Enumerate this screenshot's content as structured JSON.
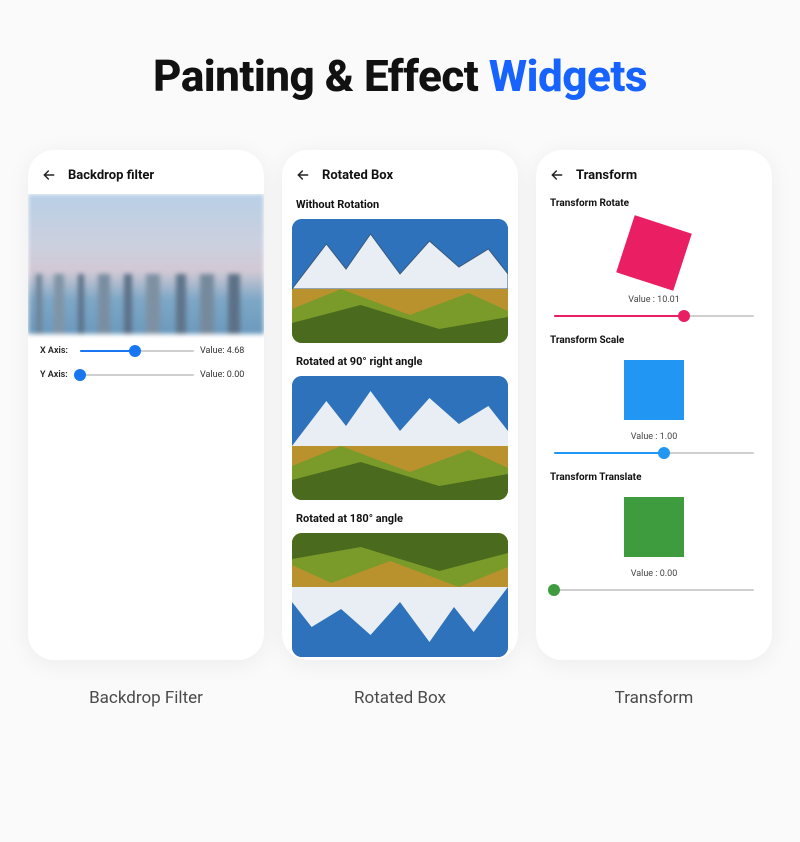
{
  "title": {
    "main": "Painting & Effect ",
    "accent": "Widgets"
  },
  "captions": [
    "Backdrop Filter",
    "Rotated Box",
    "Transform"
  ],
  "phone1": {
    "title": "Backdrop filter",
    "xAxis": {
      "label": "X Axis:",
      "valueLabel": "Value: 4.68",
      "pct": 48
    },
    "yAxis": {
      "label": "Y Axis:",
      "valueLabel": "Value: 0.00",
      "pct": 0
    }
  },
  "phone2": {
    "title": "Rotated Box",
    "sections": {
      "none": "Without Rotation",
      "r90": "Rotated at 90° right angle",
      "r180": "Rotated at 180° angle"
    }
  },
  "phone3": {
    "title": "Transform",
    "rotate": {
      "label": "Transform Rotate",
      "valueLabel": "Value : 10.01",
      "pct": 65,
      "color": "#e91e63"
    },
    "scale": {
      "label": "Transform Scale",
      "valueLabel": "Value : 1.00",
      "pct": 55,
      "color": "#2196f3"
    },
    "translate": {
      "label": "Transform Translate",
      "valueLabel": "Value : 0.00",
      "pct": 0,
      "color": "#3e9b3e"
    }
  }
}
